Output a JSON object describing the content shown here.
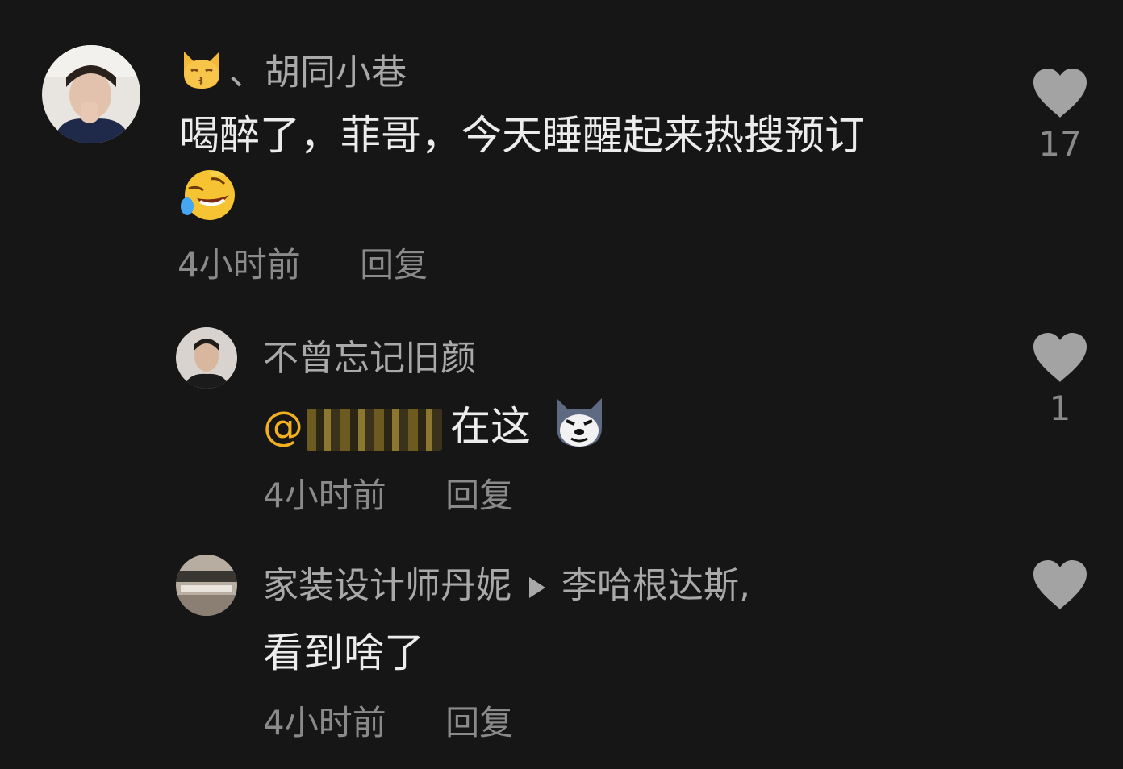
{
  "comments": [
    {
      "username": "、胡同小巷",
      "username_emoji": "kissing-cat-emoji",
      "text": "喝醉了，菲哥，今天睡醒起来热搜预订",
      "text_emoji": "rolling-laughing-emoji",
      "time": "4小时前",
      "reply_label": "回复",
      "likes": "17"
    },
    {
      "username": "不曾忘记旧颜",
      "mention_prefix": "@",
      "text": "在这",
      "text_emoji": "husky-dog-emoji",
      "time": "4小时前",
      "reply_label": "回复",
      "likes": "1"
    },
    {
      "username": "家装设计师丹妮",
      "reply_to": "李哈根达斯,",
      "text": "看到啥了",
      "time": "4小时前",
      "reply_label": "回复",
      "likes": ""
    }
  ],
  "colors": {
    "background": "#161616",
    "mention": "#f2b01e",
    "secondary": "#8a8a8a"
  }
}
